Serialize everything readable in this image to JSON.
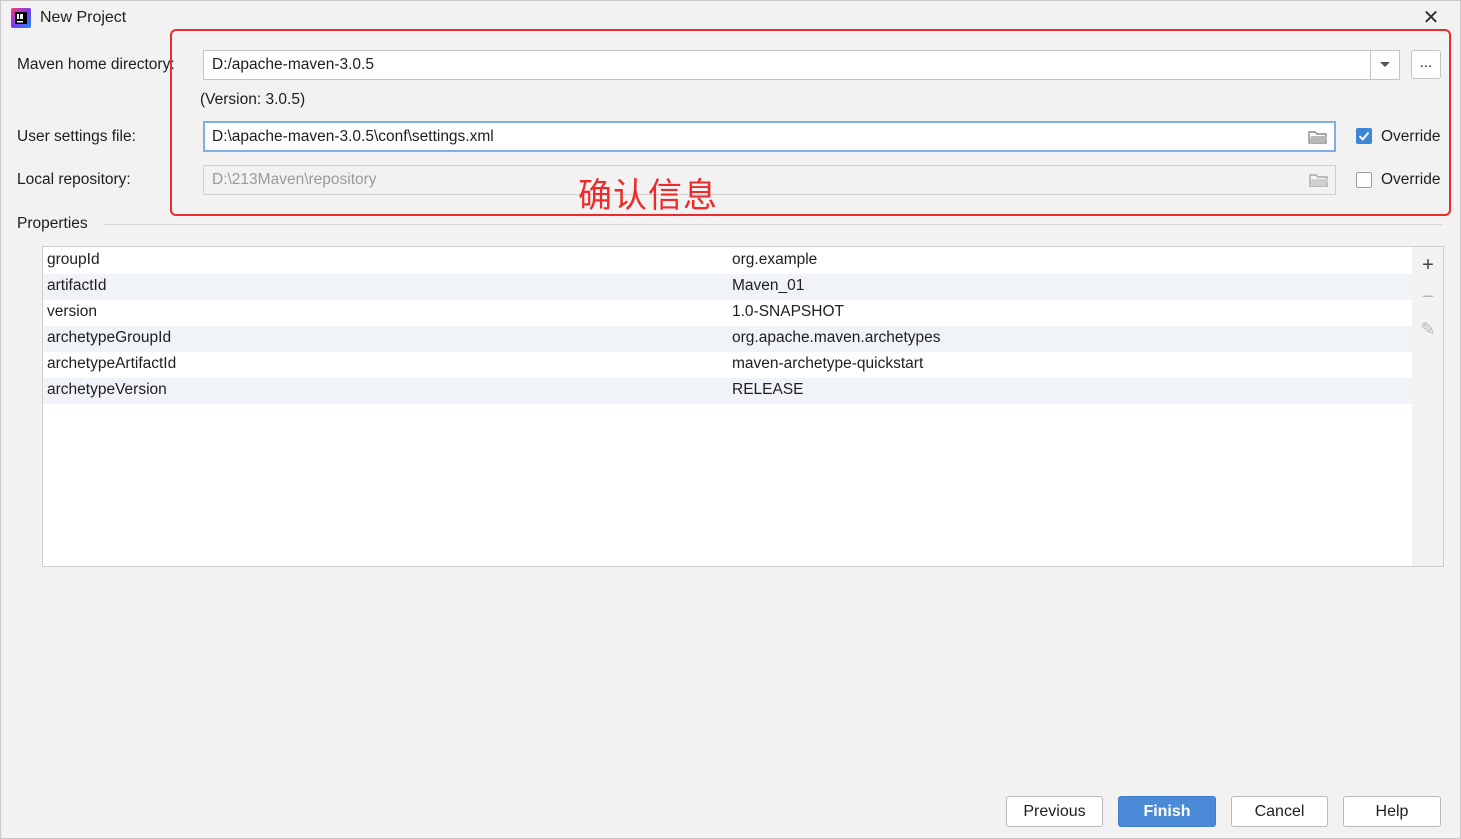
{
  "window": {
    "title": "New Project",
    "close_glyph": "✕"
  },
  "maven": {
    "home_label": "Maven home directory:",
    "home_value": "D:/apache-maven-3.0.5",
    "browse_label": "...",
    "version_text": "(Version: 3.0.5)",
    "settings_label": "User settings file:",
    "settings_value": "D:\\apache-maven-3.0.5\\conf\\settings.xml",
    "settings_override_label": "Override",
    "settings_override_checked": true,
    "repo_label": "Local repository:",
    "repo_value": "D:\\213Maven\\repository",
    "repo_override_label": "Override",
    "repo_override_checked": false
  },
  "annotation": {
    "text": "确认信息",
    "color": "#ee2b2b"
  },
  "properties": {
    "section_title": "Properties",
    "rows": [
      {
        "key": "groupId",
        "value": "org.example"
      },
      {
        "key": "artifactId",
        "value": "Maven_01"
      },
      {
        "key": "version",
        "value": "1.0-SNAPSHOT"
      },
      {
        "key": "archetypeGroupId",
        "value": "org.apache.maven.archetypes"
      },
      {
        "key": "archetypeArtifactId",
        "value": "maven-archetype-quickstart"
      },
      {
        "key": "archetypeVersion",
        "value": "RELEASE"
      }
    ],
    "tools": {
      "add": "+",
      "remove": "−",
      "edit": "✎"
    }
  },
  "buttons": {
    "previous": "Previous",
    "finish": "Finish",
    "cancel": "Cancel",
    "help": "Help"
  },
  "colors": {
    "accent": "#4a8ad6",
    "checkbox": "#3c86d8",
    "focus_border": "#7faee0"
  }
}
